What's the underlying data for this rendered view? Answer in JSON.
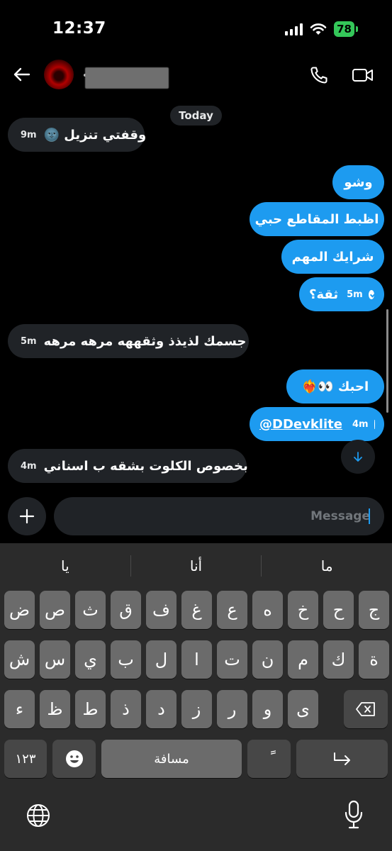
{
  "status_bar": {
    "time": "12:37",
    "battery": "78"
  },
  "header": {},
  "date_divider": "Today",
  "messages": [
    {
      "id": "m1",
      "direction": "in",
      "text": "وقفتي تنزيل 🌚",
      "time": "9m"
    },
    {
      "id": "m2",
      "direction": "out",
      "text": "وشو",
      "time": ""
    },
    {
      "id": "m3",
      "direction": "out",
      "text": "اظبط المقاطع حبي",
      "time": ""
    },
    {
      "id": "m4",
      "direction": "out",
      "text": "شرايك المهم",
      "time": ""
    },
    {
      "id": "m5",
      "direction": "out",
      "text": "ثقة؟",
      "time": "5m",
      "seen": true
    },
    {
      "id": "m6",
      "direction": "in",
      "text": "جسمك لذيذذ وثقههه مرهه مرهه",
      "time": "5m"
    },
    {
      "id": "m7",
      "direction": "out",
      "text": "احبك 👀❤️‍🔥",
      "time": ""
    },
    {
      "id": "m8",
      "direction": "out",
      "text": "@DDevklite",
      "time": "4m",
      "seen": true
    },
    {
      "id": "m9",
      "direction": "in",
      "text": "بخصوص الكلوت بشقه ب اسناني",
      "time": "4m"
    }
  ],
  "composer": {
    "placeholder": "Message"
  },
  "keyboard": {
    "suggestions": [
      "يا",
      "أنا",
      "ما"
    ],
    "row1": [
      "ض",
      "ص",
      "ث",
      "ق",
      "ف",
      "غ",
      "ع",
      "ه",
      "خ",
      "ح",
      "ج"
    ],
    "row2": [
      "ش",
      "س",
      "ي",
      "ب",
      "ل",
      "ا",
      "ت",
      "ن",
      "م",
      "ك",
      "ة"
    ],
    "row3": [
      "ء",
      "ظ",
      "ط",
      "ذ",
      "د",
      "ز",
      "ر",
      "و",
      "ى"
    ],
    "numbers_label": "١٢٣",
    "space_label": "مسافة",
    "diacritic_label": "ً",
    "icons": {
      "backspace": "backspace-icon",
      "emoji": "emoji-icon",
      "return": "return-icon",
      "globe": "globe-icon",
      "mic": "mic-icon"
    }
  },
  "colors": {
    "outgoing_bubble": "#1d9bf0",
    "incoming_bubble": "#202327",
    "battery": "#34c759"
  }
}
